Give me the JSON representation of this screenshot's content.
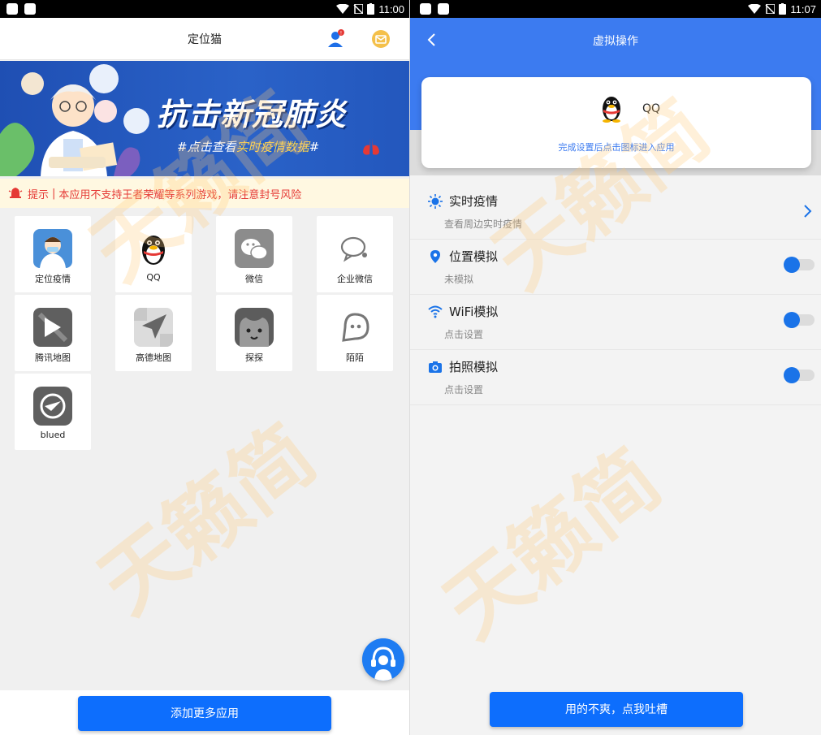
{
  "left": {
    "status": {
      "time": "11:00"
    },
    "header": {
      "title": "定位猫"
    },
    "banner": {
      "title": "抗击新冠肺炎",
      "sub_prefix": "#点击查看",
      "sub_highlight": "实时疫情数据",
      "sub_suffix": "#"
    },
    "notice": {
      "label": "提示",
      "separator": "|",
      "text": "本应用不支持王者荣耀等系列游戏，请注意封号风险"
    },
    "apps": [
      {
        "label": "定位疫情",
        "icon": "doctor-icon"
      },
      {
        "label": "QQ",
        "icon": "qq-penguin-icon"
      },
      {
        "label": "微信",
        "icon": "wechat-icon"
      },
      {
        "label": "企业微信",
        "icon": "wecom-icon"
      },
      {
        "label": "腾讯地图",
        "icon": "tencent-map-icon"
      },
      {
        "label": "高德地图",
        "icon": "amap-icon"
      },
      {
        "label": "探探",
        "icon": "tantan-icon"
      },
      {
        "label": "陌陌",
        "icon": "momo-icon"
      },
      {
        "label": "blued",
        "icon": "blued-icon"
      }
    ],
    "add_more_label": "添加更多应用"
  },
  "right": {
    "status": {
      "time": "11:07"
    },
    "header": {
      "title": "虚拟操作"
    },
    "app_card": {
      "name": "QQ",
      "hint": "完成设置后点击图标进入应用"
    },
    "rows": [
      {
        "title": "实时疫情",
        "subtitle": "查看周边实时疫情",
        "icon": "virus-icon",
        "control": "chevron"
      },
      {
        "title": "位置模拟",
        "subtitle": "未模拟",
        "icon": "location-pin-icon",
        "control": "toggle"
      },
      {
        "title": "WiFi模拟",
        "subtitle": "点击设置",
        "icon": "wifi-icon",
        "control": "toggle"
      },
      {
        "title": "拍照模拟",
        "subtitle": "点击设置",
        "icon": "camera-icon",
        "control": "toggle"
      }
    ],
    "feedback_label": "用的不爽，点我吐槽"
  },
  "watermark": "天籁简",
  "colors": {
    "primary": "#0d6efd",
    "header_blue": "#3c7bf0",
    "notice_red": "#e53935",
    "notice_bg": "#fff8e1"
  }
}
